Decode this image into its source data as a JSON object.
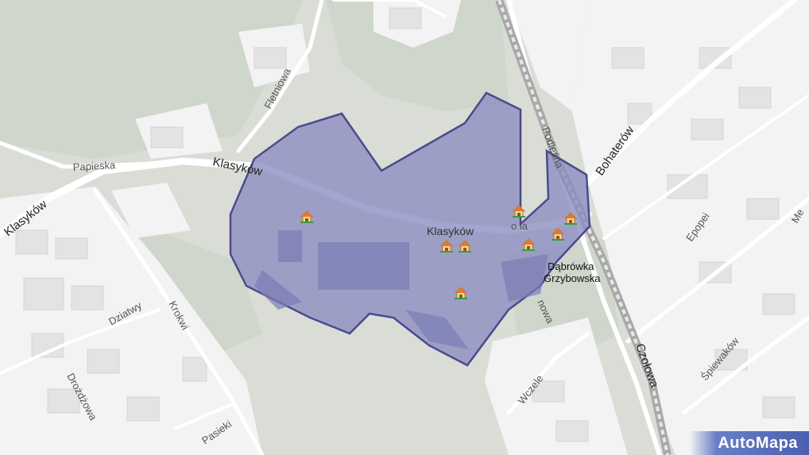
{
  "map": {
    "streets": {
      "klasykow_main": "Klasyków",
      "klasykow_west": "Klasyków",
      "klasykow_upper": "Klasyków",
      "papieska": "Papieska",
      "fletniowa": "Fletniowa",
      "podlesna": "Podleśna",
      "bohaterow": "Bohaterów",
      "czolowa": "Czołowa",
      "epopei": "Epopei",
      "spiewakow": "Śpiewaków",
      "dziatwy": "Dziatwy",
      "krokwi": "Krokwi",
      "drozdzowa": "Drożdżowa",
      "pasieki": "Pasieki",
      "wczele": "Wczele",
      "nowa": "nowa",
      "fragment_ola": "o la",
      "fragment_me": "Me"
    },
    "place": {
      "line1": "Dąbrówka",
      "line2": "Grzybowska"
    },
    "colors": {
      "background": "#d9ddd6",
      "residential": "#f4f4f4",
      "road": "#ffffff",
      "area_fill": "#8a8cc0",
      "area_stroke": "#4c4a8c",
      "railway": "#9a9a9a"
    }
  },
  "branding": {
    "logo": "AutoMapa"
  }
}
